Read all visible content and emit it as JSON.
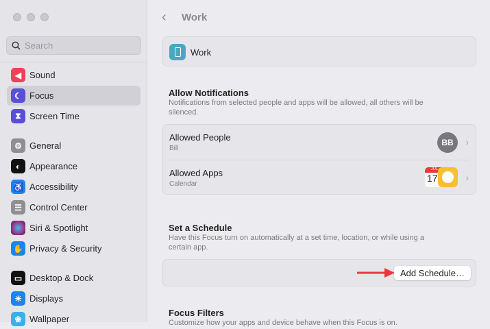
{
  "sidebar": {
    "search_placeholder": "Search",
    "items": [
      {
        "label": "Sound",
        "icon": "speaker-icon",
        "color": "#f0405a"
      },
      {
        "label": "Focus",
        "icon": "moon-icon",
        "color": "#5b4fd6"
      },
      {
        "label": "Screen Time",
        "icon": "hourglass-icon",
        "color": "#5b4fd6"
      },
      {
        "label": "General",
        "icon": "gear-icon",
        "color": "#8e8e93"
      },
      {
        "label": "Appearance",
        "icon": "appearance-icon",
        "color": "#111111"
      },
      {
        "label": "Accessibility",
        "icon": "accessibility-icon",
        "color": "#1a84f0"
      },
      {
        "label": "Control Center",
        "icon": "toggles-icon",
        "color": "#8e8e93"
      },
      {
        "label": "Siri & Spotlight",
        "icon": "siri-icon",
        "color": "#7a2d8a"
      },
      {
        "label": "Privacy & Security",
        "icon": "hand-icon",
        "color": "#1a84f0"
      },
      {
        "label": "Desktop & Dock",
        "icon": "dock-icon",
        "color": "#111111"
      },
      {
        "label": "Displays",
        "icon": "sun-icon",
        "color": "#1a84f0"
      },
      {
        "label": "Wallpaper",
        "icon": "flower-icon",
        "color": "#3ab0e8"
      }
    ]
  },
  "header": {
    "title": "Work"
  },
  "focus_card": {
    "name": "Work"
  },
  "allow": {
    "heading": "Allow Notifications",
    "description": "Notifications from selected people and apps will be allowed, all others will be silenced.",
    "people": {
      "title": "Allowed People",
      "subtitle": "Bill",
      "avatar": "BB"
    },
    "apps": {
      "title": "Allowed Apps",
      "subtitle": "Calendar",
      "cal_month": "JUL",
      "cal_day": "17"
    }
  },
  "schedule": {
    "heading": "Set a Schedule",
    "description": "Have this Focus turn on automatically at a set time, location, or while using a certain app.",
    "button": "Add Schedule…"
  },
  "filters": {
    "heading": "Focus Filters",
    "description": "Customize how your apps and device behave when this Focus is on."
  },
  "colors": {
    "arrow": "#e8383d",
    "accent": "#5b4fd6"
  }
}
